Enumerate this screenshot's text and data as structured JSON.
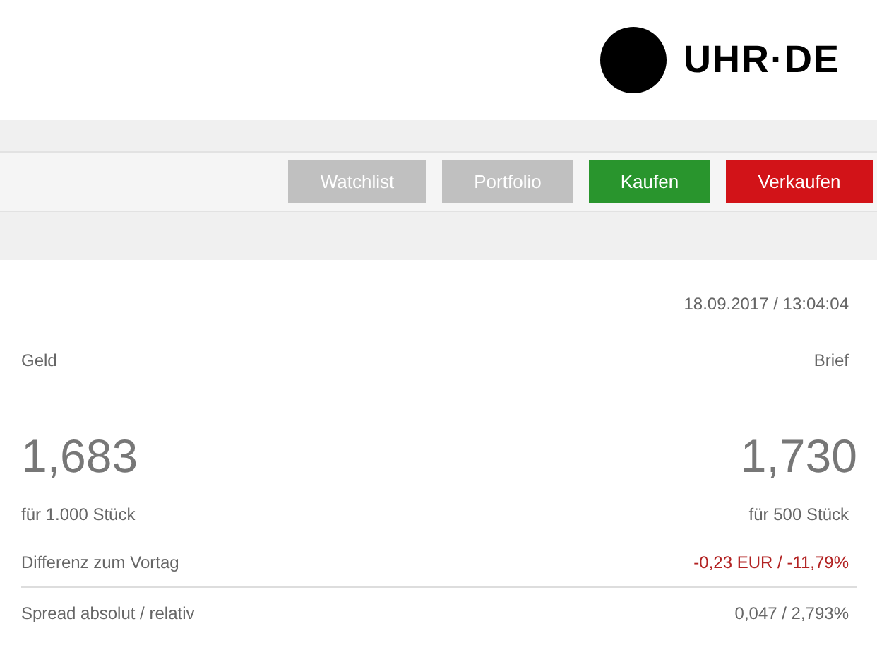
{
  "logo": {
    "text": "UHR·DE"
  },
  "buttons": [
    {
      "label": "Watchlist",
      "kind": "neutral"
    },
    {
      "label": "Portfolio",
      "kind": "neutral"
    },
    {
      "label": "Kaufen",
      "kind": "buy"
    },
    {
      "label": "Verkaufen",
      "kind": "sell"
    }
  ],
  "timestamp": "18.09.2017 / 13:04:04",
  "quotes": [
    {
      "label": "Geld",
      "price": "1,683",
      "size": "für 1.000 Stück"
    },
    {
      "label": "Brief",
      "price": "1,730",
      "size": "für 500 Stück"
    }
  ],
  "stats": [
    {
      "label": "Differenz zum Vortag",
      "value": "-0,23 EUR / -11,79%",
      "kind": "negative"
    },
    {
      "label": "Spread absolut / relativ",
      "value": "0,047 / 2,793%",
      "kind": "neutral"
    }
  ]
}
